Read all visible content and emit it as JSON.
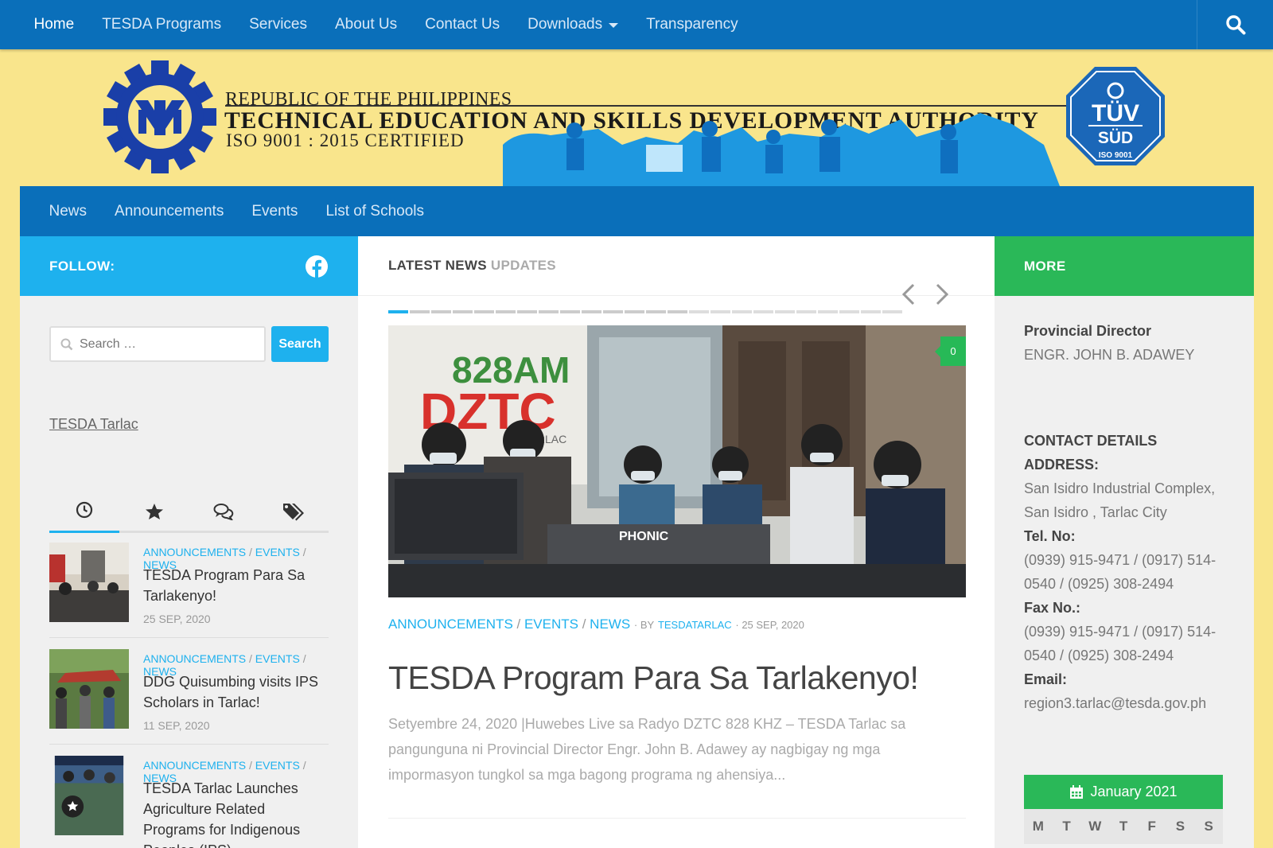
{
  "topnav": {
    "items": [
      {
        "label": "Home",
        "active": true
      },
      {
        "label": "TESDA Programs"
      },
      {
        "label": "Services"
      },
      {
        "label": "About Us"
      },
      {
        "label": "Contact Us"
      },
      {
        "label": "Downloads",
        "dropdown": true
      },
      {
        "label": "Transparency"
      }
    ]
  },
  "header": {
    "line1": "REPUBLIC OF THE PHILIPPINES",
    "line2": "TECHNICAL EDUCATION AND SKILLS DEVELOPMENT AUTHORITY",
    "line3": "ISO 9001 : 2015 CERTIFIED",
    "tuv_name": "TÜV SÜD",
    "tuv_sub": "ISO 9001"
  },
  "subnav": {
    "items": [
      "News",
      "Announcements",
      "Events",
      "List of Schools"
    ]
  },
  "left": {
    "follow_label": "FOLLOW:",
    "search": {
      "placeholder": "Search …",
      "button": "Search"
    },
    "link": "TESDA Tarlac",
    "posts": [
      {
        "cats": [
          "ANNOUNCEMENTS",
          "EVENTS",
          "NEWS"
        ],
        "title": "TESDA Program Para Sa Tarlakenyo!",
        "date": "25 SEP, 2020"
      },
      {
        "cats": [
          "ANNOUNCEMENTS",
          "EVENTS",
          "NEWS"
        ],
        "title": "DDG Quisumbing visits IPS Scholars in Tarlac!",
        "date": "11 SEP, 2020"
      },
      {
        "cats": [
          "ANNOUNCEMENTS",
          "EVENTS",
          "NEWS"
        ],
        "title": "TESDA Tarlac Launches Agriculture Related Programs for Indigenous Peoples (IPS)",
        "date": ""
      }
    ]
  },
  "center": {
    "head_1": "LATEST NEWS",
    "head_2": "UPDATES",
    "comment_count": "0",
    "meta": {
      "cat1": "ANNOUNCEMENTS",
      "cat2": "EVENTS",
      "cat3": "NEWS",
      "by": "· BY",
      "author": "TESDATARLAC",
      "date": "· 25 SEP, 2020"
    },
    "title": "TESDA Program Para Sa Tarlakenyo!",
    "excerpt": "Setyembre 24, 2020 |Huwebes Live sa Radyo DZTC 828 KHZ – TESDA Tarlac sa pangunguna ni Provincial Director Engr. John B. Adawey ay nagbigay ng mga impormasyon tungkol sa mga bagong programa ng ahensiya...",
    "photo_sign_1": "828AM",
    "photo_sign_2": "DZTC",
    "photo_sign_3": "TARLAC",
    "photo_mixer": "PHONIC"
  },
  "right": {
    "head": "MORE",
    "pd_label": "Provincial Director",
    "pd_name": "ENGR. JOHN B. ADAWEY",
    "contact_head": "CONTACT DETAILS",
    "address_label": "ADDRESS:",
    "address": "San Isidro Industrial Complex, San Isidro , Tarlac City",
    "tel_label": "Tel. No:",
    "tel": "(0939) 915-9471 / (0917) 514-0540 / (0925) 308-2494",
    "fax_label": "Fax No.:",
    "fax": "(0939) 915-9471 / (0917) 514-0540 / (0925) 308-2494",
    "email_label": "Email:",
    "email": "region3.tarlac@tesda.gov.ph",
    "calendar_title": "January 2021",
    "calendar_days": [
      "M",
      "T",
      "W",
      "T",
      "F",
      "S",
      "S"
    ]
  },
  "colors": {
    "nav_blue": "#0a6fba",
    "accent_blue": "#1eb1ee",
    "green": "#2ab858",
    "header_yellow": "#f9e58c"
  },
  "icons": [
    "search-icon",
    "facebook-icon",
    "clock-icon",
    "star-icon",
    "comments-icon",
    "tags-icon",
    "chevron-left-icon",
    "chevron-right-icon",
    "calendar-icon"
  ]
}
